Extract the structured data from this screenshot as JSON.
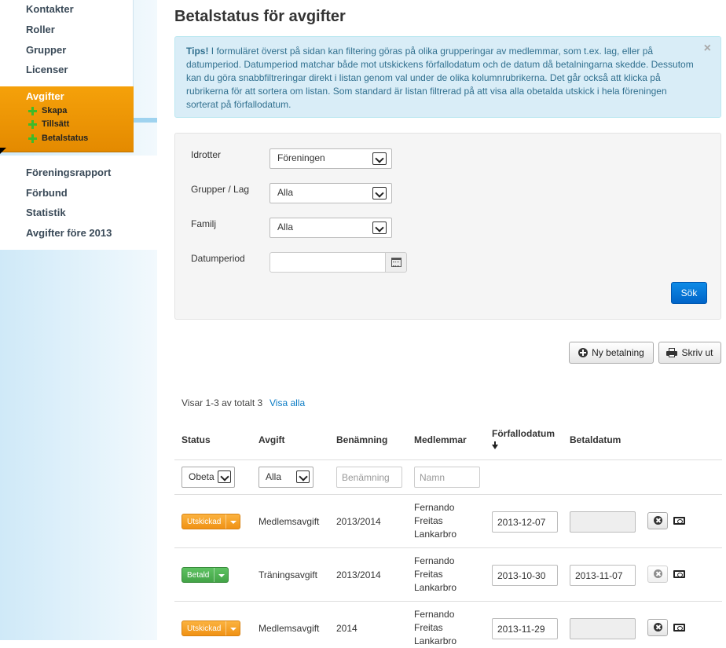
{
  "sidebar": {
    "items_top": [
      "Kontakter",
      "Roller",
      "Grupper",
      "Licenser"
    ],
    "active": {
      "title": "Avgifter",
      "subitems": [
        "Skapa",
        "Tillsätt",
        "Betalstatus"
      ]
    },
    "items_bottom": [
      "Föreningsrapport",
      "Förbund",
      "Statistik",
      "Avgifter före 2013"
    ]
  },
  "page": {
    "title": "Betalstatus för avgifter"
  },
  "tips": {
    "label": "Tips!",
    "text": "I formuläret överst på sidan kan filtering göras på olika grupperingar av medlemmar, som t.ex. lag, eller på datumperiod. Datumperiod matchar både mot utskickens förfallodatum och de datum då betalningarna skedde. Dessutom kan du göra snabbfiltreringar direkt i listan genom val under de olika kolumnrubrikerna. Det går också att klicka på rubrikerna för att sortera om listan. Som standard är listan filtrerad på att visa alla obetalda utskick i hela föreningen sorterat på förfallodatum.",
    "close": "×"
  },
  "filters": {
    "sports": {
      "label": "Idrotter",
      "value": "Föreningen"
    },
    "groups": {
      "label": "Grupper / Lag",
      "value": "Alla"
    },
    "family": {
      "label": "Familj",
      "value": "Alla"
    },
    "date_period": {
      "label": "Datumperiod",
      "value": ""
    },
    "search_label": "Sök"
  },
  "toolbar": {
    "new_payment": "Ny betalning",
    "print": "Skriv ut"
  },
  "results": {
    "count_text": "Visar 1-3 av totalt 3",
    "show_all": "Visa alla"
  },
  "table": {
    "headers": {
      "status": "Status",
      "fee": "Avgift",
      "name": "Benämning",
      "members": "Medlemmar",
      "due": "Förfallodatum",
      "paid": "Betaldatum"
    },
    "filters": {
      "status": "Obeta",
      "fee": "Alla",
      "name_placeholder": "Benämning",
      "member_placeholder": "Namn"
    },
    "rows": [
      {
        "status": "Utskickad",
        "status_color": "#f39c12",
        "fee": "Medlemsavgift",
        "name": "2013/2014",
        "member": [
          "Fernando",
          "Freitas",
          "Lankarbro"
        ],
        "due": "2013-12-07",
        "paid": ""
      },
      {
        "status": "Betald",
        "status_color": "#4cae4c",
        "fee": "Träningsavgift",
        "name": "2013/2014",
        "member": [
          "Fernando",
          "Freitas",
          "Lankarbro"
        ],
        "due": "2013-10-30",
        "paid": "2013-11-07"
      },
      {
        "status": "Utskickad",
        "status_color": "#f39c12",
        "fee": "Medlemsavgift",
        "name": "2014",
        "member": [
          "Fernando",
          "Freitas",
          "Lankarbro"
        ],
        "due": "2013-11-29",
        "paid": ""
      }
    ]
  }
}
